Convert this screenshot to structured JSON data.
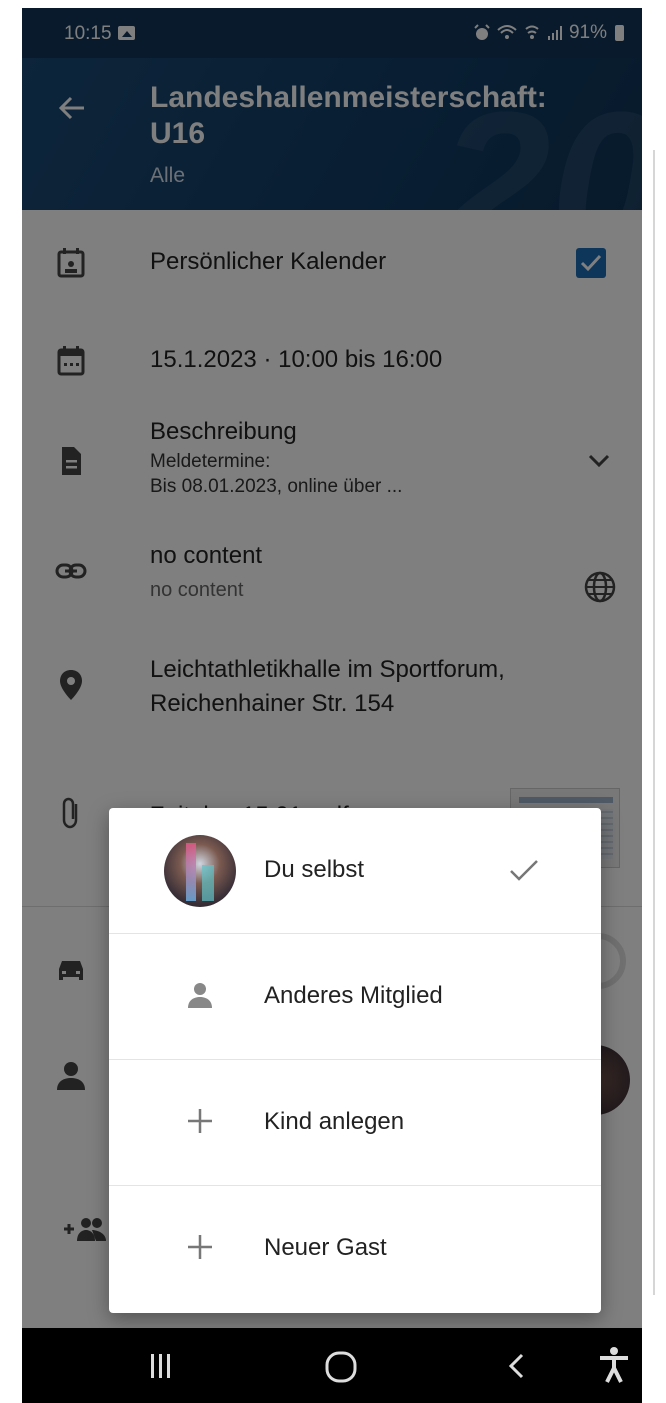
{
  "status_bar": {
    "time": "10:15",
    "battery": "91%"
  },
  "header": {
    "title_line1": "Landeshallenmeisterschaft:",
    "title_line2": "U16",
    "subtitle": "Alle"
  },
  "event": {
    "calendar_label": "Persönlicher Kalender",
    "calendar_checked": true,
    "datetime": "15.1.2023 · 10:00 bis 16:00",
    "description_title": "Beschreibung",
    "description_line1": "Meldetermine:",
    "description_line2": "Bis 08.01.2023, online über ...",
    "link_title": "no content",
    "link_sub": "no content",
    "location_line1": "Leichtathletikhalle im Sportforum,",
    "location_line2": "Reichenhainer Str. 154",
    "attachment": "Zeitplan 15.01..pdf"
  },
  "menu": {
    "items": [
      {
        "label": "Du selbst",
        "icon": "avatar",
        "selected": true
      },
      {
        "label": "Anderes Mitglied",
        "icon": "person-icon"
      },
      {
        "label": "Kind anlegen",
        "icon": "plus-icon"
      },
      {
        "label": "Neuer Gast",
        "icon": "plus-icon"
      }
    ]
  },
  "colors": {
    "header": "#113559",
    "checkbox": "#1a6db5",
    "scrim": "rgba(0,0,0,0.5)"
  }
}
